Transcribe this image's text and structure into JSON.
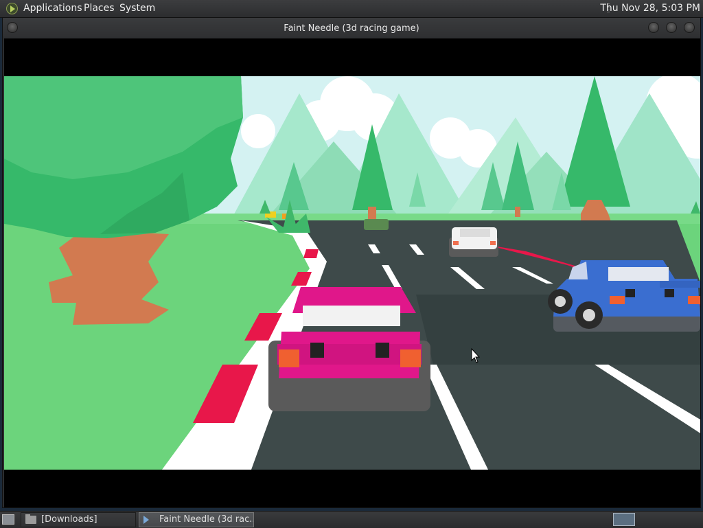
{
  "top_panel": {
    "menus": [
      "Applications",
      "Places",
      "System"
    ],
    "clock": "Thu Nov 28,  5:03 PM"
  },
  "window": {
    "title": "Faint Needle (3d racing game)"
  },
  "taskbar": {
    "items": [
      {
        "label": "[Downloads]",
        "icon": "folder-icon"
      },
      {
        "label": "Faint Needle (3d rac...",
        "icon": "game-icon"
      }
    ]
  },
  "colors": {
    "sky": "#d4f2f2",
    "grass": "#6cd47c",
    "road": "#3e4a4a",
    "curb_red": "#e8174a",
    "player_car": "#e0178a",
    "blue_car": "#3a6ed0",
    "tree": "#36b96a",
    "trunk": "#d27a50"
  }
}
